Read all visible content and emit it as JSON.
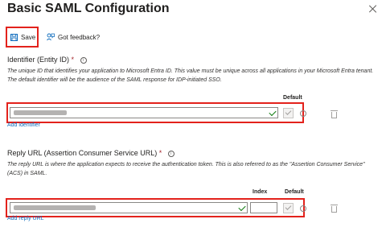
{
  "panel": {
    "title": "Basic SAML Configuration"
  },
  "toolbar": {
    "save_label": "Save",
    "feedback_label": "Got feedback?"
  },
  "identifier": {
    "title": "Identifier (Entity ID)",
    "required_mark": "*",
    "description": "The unique ID that identifies your application to Microsoft Entra ID. This value must be unique across all applications in your Microsoft Entra tenant. The default identifier will be the audience of the SAML response for IDP-initiated SSO.",
    "default_header": "Default",
    "add_link": "Add identifier"
  },
  "reply_url": {
    "title": "Reply URL (Assertion Consumer Service URL)",
    "required_mark": "*",
    "description": "The reply URL is where the application expects to receive the authentication token. This is also referred to as the \"Assertion Consumer Service\" (ACS) in SAML.",
    "index_header": "Index",
    "default_header": "Default",
    "add_link": "Add reply URL"
  },
  "colors": {
    "accent": "#0f6cbd",
    "highlight": "#e3221c",
    "valid": "#107c10"
  },
  "icons": [
    "close-icon",
    "save-icon",
    "feedback-icon",
    "info-icon",
    "checkmark-icon",
    "delete-icon"
  ]
}
